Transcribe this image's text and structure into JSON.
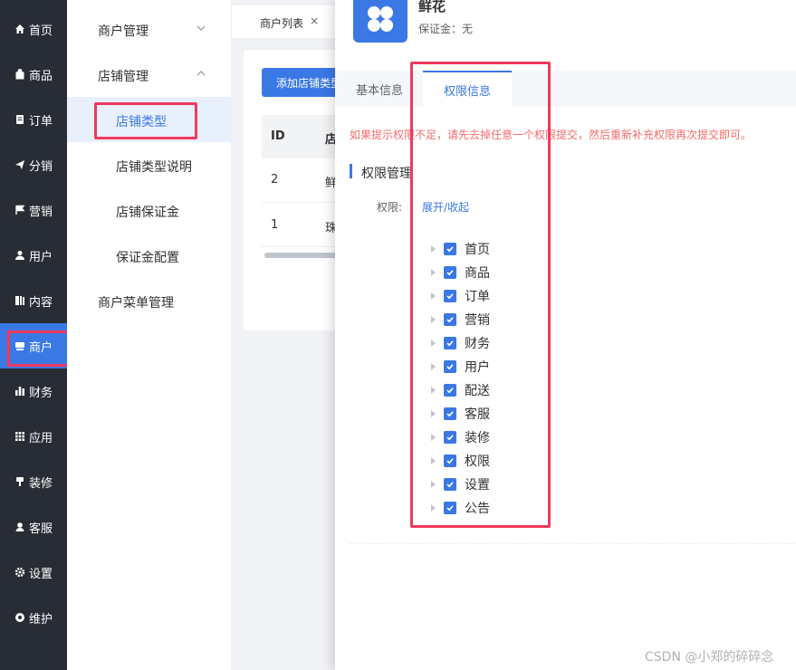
{
  "sidebar": {
    "items": [
      {
        "label": "首页",
        "icon": "home-icon"
      },
      {
        "label": "商品",
        "icon": "bag-icon"
      },
      {
        "label": "订单",
        "icon": "order-icon"
      },
      {
        "label": "分销",
        "icon": "send-icon"
      },
      {
        "label": "营销",
        "icon": "flag-icon"
      },
      {
        "label": "用户",
        "icon": "user-icon"
      },
      {
        "label": "内容",
        "icon": "content-icon"
      },
      {
        "label": "商户",
        "icon": "shop-icon"
      },
      {
        "label": "财务",
        "icon": "bar-chart-icon"
      },
      {
        "label": "应用",
        "icon": "grid-icon"
      },
      {
        "label": "装修",
        "icon": "brush-icon"
      },
      {
        "label": "客服",
        "icon": "service-icon"
      },
      {
        "label": "设置",
        "icon": "gear-icon"
      },
      {
        "label": "维护",
        "icon": "maintain-icon"
      }
    ],
    "active_index": 7
  },
  "submenu": {
    "merchant_manage": "商户管理",
    "shop_manage": "店铺管理",
    "shop_type": "店铺类型",
    "shop_type_desc": "店铺类型说明",
    "shop_deposit": "店铺保证金",
    "deposit_config": "保证金配置",
    "merchant_menu": "商户菜单管理"
  },
  "tabs": {
    "merchant_list": "商户列表",
    "close": "×"
  },
  "background": {
    "add_button": "添加店铺类型",
    "col_id": "ID",
    "col_name": "店",
    "rows": [
      {
        "id": "2",
        "name": "鲜"
      },
      {
        "id": "1",
        "name": "珠"
      }
    ]
  },
  "drawer": {
    "shop_name": "鲜花",
    "deposit": "保证金：无",
    "tab_basic": "基本信息",
    "tab_perm": "权限信息",
    "warning": "如果提示权限不足，请先去掉任意一个权限提交，然后重新补充权限再次提交即可。",
    "section_title": "权限管理",
    "perm_label": "权限:",
    "perm_toggle": "展开/收起",
    "permissions": [
      "首页",
      "商品",
      "订单",
      "营销",
      "财务",
      "用户",
      "配送",
      "客服",
      "装修",
      "权限",
      "设置",
      "公告"
    ]
  },
  "watermark": "CSDN @小郑的碎碎念",
  "colors": {
    "accent": "#3a78e6",
    "sidebar_bg": "#282c34",
    "highlight": "#f0395c",
    "warning": "#f56c6c"
  }
}
